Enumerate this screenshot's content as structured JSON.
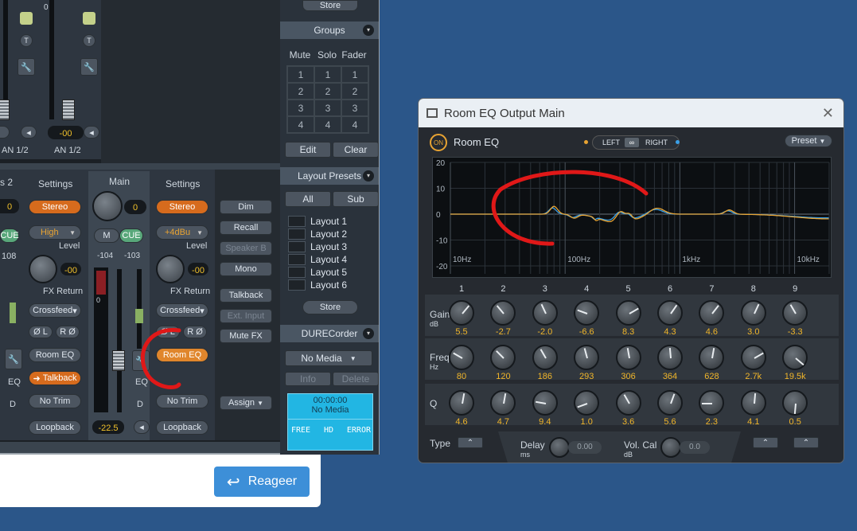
{
  "reply": {
    "label": "Reageer"
  },
  "mixer": {
    "store_top": "Store",
    "groups": {
      "title": "Groups",
      "headers": [
        "Mute",
        "Solo",
        "Fader"
      ],
      "rows": [
        [
          "1",
          "1",
          "1"
        ],
        [
          "2",
          "2",
          "2"
        ],
        [
          "3",
          "3",
          "3"
        ],
        [
          "4",
          "4",
          "4"
        ]
      ],
      "edit": "Edit",
      "clear": "Clear"
    },
    "layout_presets": {
      "title": "Layout Presets",
      "all": "All",
      "sub": "Sub",
      "items": [
        "Layout 1",
        "Layout 2",
        "Layout 3",
        "Layout 4",
        "Layout 5",
        "Layout 6"
      ],
      "store": "Store"
    },
    "durec": {
      "title": "DURECorder",
      "media": "No Media",
      "info": "Info",
      "delete": "Delete",
      "time": "00:00:00",
      "status": "No Media",
      "free": "FREE",
      "hd": "HD",
      "error": "ERROR"
    },
    "ch_left": {
      "label": "AN 1/2",
      "partial_label": "AN 1/2",
      "value": "-00",
      "s2": "s 2",
      "zero": "0",
      "cue": "CUE",
      "n108": "108",
      "eq": "EQ",
      "d": "D"
    },
    "settings1": {
      "title": "Settings",
      "stereo": "Stereo",
      "high": "High",
      "level": "Level",
      "level_val": "-00",
      "fxreturn": "FX Return",
      "crossfeed": "Crossfeed",
      "phase_l": "Ø L",
      "phase_r": "R Ø",
      "roomeq": "Room EQ",
      "talkback": "Talkback",
      "notrim": "No Trim",
      "loopback": "Loopback"
    },
    "main": {
      "title": "Main",
      "value": "0",
      "m": "M",
      "cue": "CUE",
      "lvl_l": "-104",
      "lvl_r": "-103",
      "scale0": "0",
      "fader_val": "-22.5",
      "eq": "EQ",
      "d": "D"
    },
    "settings2": {
      "title": "Settings",
      "stereo": "Stereo",
      "ref": "+4dBu",
      "level": "Level",
      "level_val": "-00",
      "fxreturn": "FX Return",
      "crossfeed": "Crossfeed",
      "phase_l": "Ø L",
      "phase_r": "R Ø",
      "roomeq": "Room EQ",
      "notrim": "No Trim",
      "loopback": "Loopback"
    },
    "right_col": {
      "dim": "Dim",
      "recall": "Recall",
      "speakerb": "Speaker B",
      "mono": "Mono",
      "talkback": "Talkback",
      "extinput": "Ext. Input",
      "mutefx": "Mute FX",
      "assign": "Assign"
    }
  },
  "eq_window": {
    "title": "Room EQ Output Main",
    "on": "ON",
    "name": "Room EQ",
    "left": "LEFT",
    "right": "RIGHT",
    "preset": "Preset",
    "y_ticks": [
      "20",
      "10",
      "0",
      "-10",
      "-20"
    ],
    "x_ticks": [
      "10Hz",
      "100Hz",
      "1kHz",
      "10kHz"
    ],
    "bands": [
      "1",
      "2",
      "3",
      "4",
      "5",
      "6",
      "7",
      "8",
      "9"
    ],
    "gain_label": "Gain",
    "gain_unit": "dB",
    "freq_label": "Freq",
    "freq_unit": "Hz",
    "q_label": "Q",
    "type_label": "Type",
    "gain": [
      "5.5",
      "-2.7",
      "-2.0",
      "-6.6",
      "8.3",
      "4.3",
      "4.6",
      "3.0",
      "-3.3"
    ],
    "freq": [
      "80",
      "120",
      "186",
      "293",
      "306",
      "364",
      "628",
      "2.7k",
      "19.5k"
    ],
    "q": [
      "4.6",
      "4.7",
      "9.4",
      "1.0",
      "3.6",
      "5.6",
      "2.3",
      "4.1",
      "0.5"
    ],
    "delay_label": "Delay",
    "delay_unit": "ms",
    "delay_value": "0.00",
    "volcal_label": "Vol. Cal",
    "volcal_unit": "dB",
    "volcal_value": "0.0"
  }
}
